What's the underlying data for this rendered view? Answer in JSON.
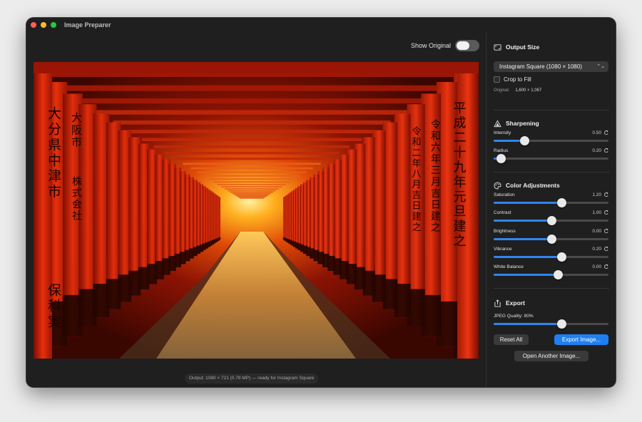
{
  "window": {
    "title": "Image Preparer"
  },
  "preview": {
    "show_original_label": "Show Original",
    "show_original_on": false,
    "status": "Output: 1080 × 721 (0.78 MP) — ready for Instagram Square",
    "signs_left": [
      "大分県中津市",
      "大阪市",
      "株式会社",
      "保科実"
    ],
    "signs_right": [
      "平成二十九年元旦建之",
      "令和六年三月吉日建之",
      "令和二年八月吉日建之"
    ]
  },
  "output_size": {
    "title": "Output Size",
    "icon": "aspect-ratio-icon",
    "preset": "Instagram Square (1080 × 1080)",
    "crop_to_fill_label": "Crop to Fill",
    "crop_to_fill_checked": false,
    "original_label": "Original:",
    "original_value": "1,600 × 1,067"
  },
  "sharpening": {
    "title": "Sharpening",
    "icon": "triangle-icon",
    "sliders": [
      {
        "name": "Intensity",
        "value": "0.50",
        "fraction": 0.27
      },
      {
        "name": "Radius",
        "value": "0.20",
        "fraction": 0.06
      }
    ]
  },
  "color": {
    "title": "Color Adjustments",
    "icon": "palette-icon",
    "sliders": [
      {
        "name": "Saturation",
        "value": "1.20",
        "fraction": 0.59
      },
      {
        "name": "Contrast",
        "value": "1.00",
        "fraction": 0.5
      },
      {
        "name": "Brightness",
        "value": "0.00",
        "fraction": 0.5
      },
      {
        "name": "Vibrance",
        "value": "0.20",
        "fraction": 0.59
      },
      {
        "name": "White Balance",
        "value": "0.00",
        "fraction": 0.56
      }
    ]
  },
  "export": {
    "title": "Export",
    "icon": "share-icon",
    "quality_label": "JPEG Quality: 80%",
    "quality_fraction": 0.59,
    "reset_label": "Reset All",
    "export_label": "Export Image...",
    "open_label": "Open Another Image..."
  },
  "colors": {
    "accent": "#1f7ff0",
    "torii": "#d42410",
    "background": "#1f1f1f"
  }
}
